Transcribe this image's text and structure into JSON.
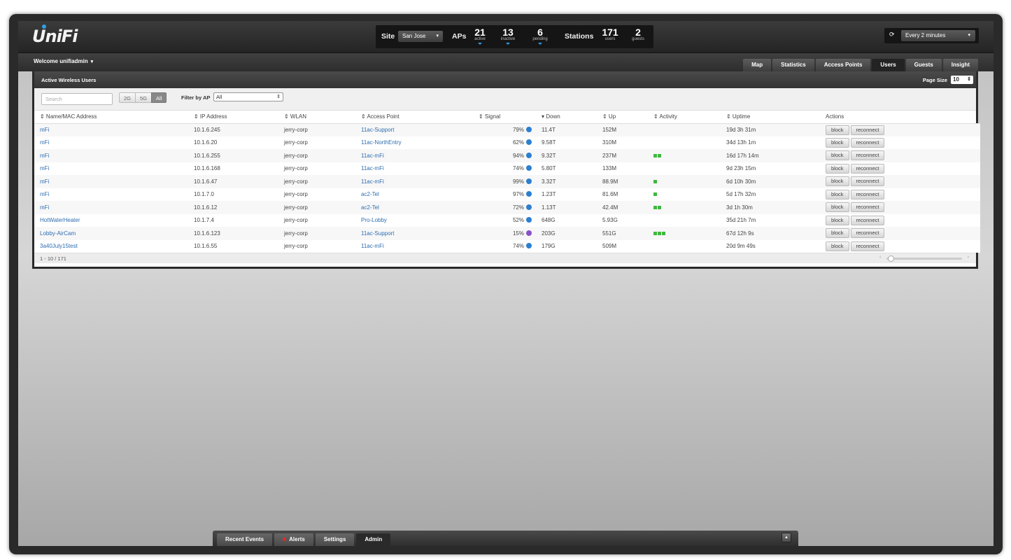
{
  "brand": {
    "logo_text": "UniFi"
  },
  "header": {
    "site_label": "Site",
    "site_value": "San Jose",
    "aps_label": "APs",
    "aps": [
      {
        "num": "21",
        "sub": "active"
      },
      {
        "num": "13",
        "sub": "inactive"
      },
      {
        "num": "6",
        "sub": "pending"
      }
    ],
    "stations_label": "Stations",
    "stations": [
      {
        "num": "171",
        "sub": "users"
      },
      {
        "num": "2",
        "sub": "guests"
      }
    ],
    "refresh_icon": "refresh-icon",
    "refresh_value": "Every 2 minutes"
  },
  "subbar": {
    "welcome": "Welcome unifiadmin",
    "tabs": [
      "Map",
      "Statistics",
      "Access Points",
      "Users",
      "Guests",
      "Insight"
    ],
    "active_tab": "Users"
  },
  "panel": {
    "title": "Active Wireless Users",
    "page_size_label": "Page Size",
    "page_size_value": "10",
    "search_placeholder": "Search",
    "band_buttons": [
      "2G",
      "5G",
      "All"
    ],
    "active_band": "All",
    "filter_label": "Filter by AP",
    "filter_value": "All",
    "columns": [
      "⇕ Name/MAC Address",
      "⇕ IP Address",
      "⇕ WLAN",
      "⇕ Access Point",
      "⇕ Signal",
      "▾ Down",
      "⇕ Up",
      "⇕ Activity",
      "⇕ Uptime",
      "Actions"
    ],
    "rows": [
      {
        "name": "mFi",
        "ip": "10.1.6.245",
        "wlan": "jerry-corp",
        "ap": "11ac-Support",
        "signal": "79%",
        "radio": "n",
        "down": "11.4T",
        "up": "152M",
        "activity": 0,
        "uptime": "19d 3h 31m"
      },
      {
        "name": "mFi",
        "ip": "10.1.6.20",
        "wlan": "jerry-corp",
        "ap": "11ac-NorthEntry",
        "signal": "62%",
        "radio": "n",
        "down": "9.58T",
        "up": "310M",
        "activity": 0,
        "uptime": "34d 13h 1m"
      },
      {
        "name": "mFi",
        "ip": "10.1.6.255",
        "wlan": "jerry-corp",
        "ap": "11ac-mFi",
        "signal": "94%",
        "radio": "n",
        "down": "9.32T",
        "up": "237M",
        "activity": 2,
        "uptime": "16d 17h 14m"
      },
      {
        "name": "mFi",
        "ip": "10.1.6.168",
        "wlan": "jerry-corp",
        "ap": "11ac-mFi",
        "signal": "74%",
        "radio": "n",
        "down": "5.80T",
        "up": "133M",
        "activity": 0,
        "uptime": "9d 23h 15m"
      },
      {
        "name": "mFi",
        "ip": "10.1.6.47",
        "wlan": "jerry-corp",
        "ap": "11ac-mFi",
        "signal": "99%",
        "radio": "n",
        "down": "3.32T",
        "up": "88.9M",
        "activity": 1,
        "uptime": "6d 10h 30m"
      },
      {
        "name": "mFi",
        "ip": "10.1.7.0",
        "wlan": "jerry-corp",
        "ap": "ac2-Tel",
        "signal": "97%",
        "radio": "n",
        "down": "1.23T",
        "up": "81.6M",
        "activity": 1,
        "uptime": "5d 17h 32m"
      },
      {
        "name": "mFi",
        "ip": "10.1.6.12",
        "wlan": "jerry-corp",
        "ap": "ac2-Tel",
        "signal": "72%",
        "radio": "n",
        "down": "1.13T",
        "up": "42.4M",
        "activity": 2,
        "uptime": "3d 1h 30m"
      },
      {
        "name": "HotWaterHeater",
        "ip": "10.1.7.4",
        "wlan": "jerry-corp",
        "ap": "Pro-Lobby",
        "signal": "52%",
        "radio": "n",
        "down": "648G",
        "up": "5.93G",
        "activity": 0,
        "uptime": "35d 21h 7m"
      },
      {
        "name": "Lobby-AirCam",
        "ip": "10.1.6.123",
        "wlan": "jerry-corp",
        "ap": "11ac-Support",
        "signal": "15%",
        "radio": "na",
        "down": "203G",
        "up": "551G",
        "activity": 3,
        "uptime": "67d 12h 9s"
      },
      {
        "name": "3a40July15test",
        "ip": "10.1.6.55",
        "wlan": "jerry-corp",
        "ap": "11ac-mFi",
        "signal": "74%",
        "radio": "n",
        "down": "179G",
        "up": "509M",
        "activity": 0,
        "uptime": "20d 9m 49s"
      }
    ],
    "action_block": "block",
    "action_reconnect": "reconnect",
    "footer_count": "1 - 10 / 171"
  },
  "bottom": {
    "tabs": [
      "Recent Events",
      "Alerts",
      "Settings",
      "Admin"
    ],
    "active_tab": "Admin"
  },
  "colors": {
    "accent": "#2f9fe6",
    "link": "#2e6db0",
    "activity": "#3fb83f",
    "alert": "#e02b2b"
  }
}
